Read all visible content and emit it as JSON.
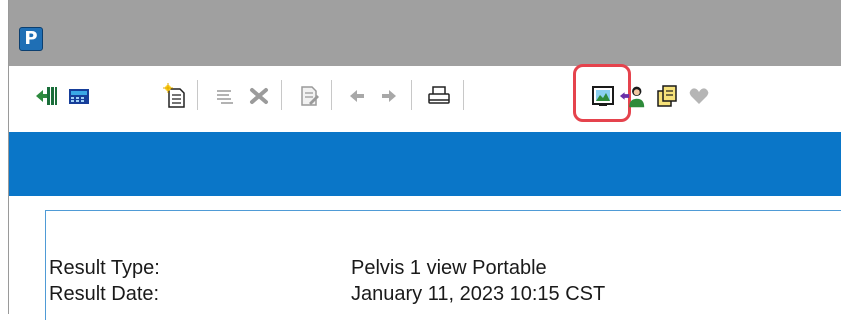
{
  "titlebar": {
    "app_letter": "P",
    "color": "#a0a0a0"
  },
  "toolbar": {
    "items": [
      {
        "name": "exit-icon"
      },
      {
        "name": "calculator-icon"
      },
      {
        "name": "new-document-icon"
      },
      {
        "name": "text-format-icon"
      },
      {
        "name": "delete-x-icon"
      },
      {
        "name": "document-edit-icon"
      },
      {
        "name": "arrow-left-icon"
      },
      {
        "name": "arrow-right-icon"
      },
      {
        "name": "print-icon"
      },
      {
        "name": "image-viewer-icon",
        "highlighted": true
      },
      {
        "name": "person-forward-icon"
      },
      {
        "name": "copy-icon"
      },
      {
        "name": "heart-icon"
      }
    ],
    "highlight_color": "#e5434d"
  },
  "banner": {
    "color": "#0a76c8"
  },
  "result": {
    "type_label": "Result Type:",
    "type_value": "Pelvis 1 view Portable",
    "date_label": "Result Date:",
    "date_value": "January 11, 2023 10:15 CST"
  }
}
